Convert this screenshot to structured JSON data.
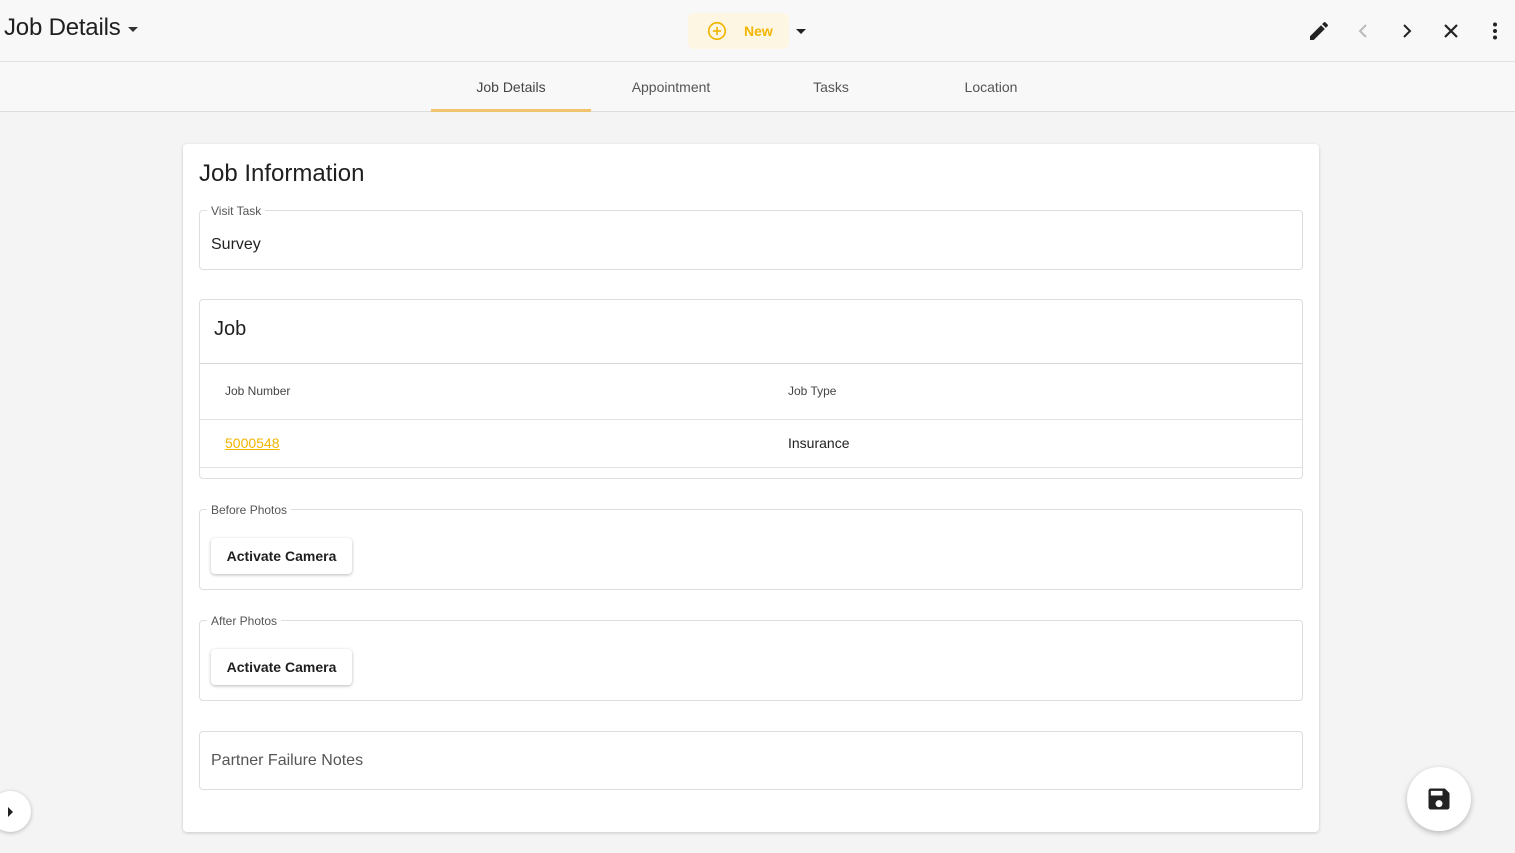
{
  "header": {
    "title": "Job Details",
    "new_label": "New",
    "icons": [
      "edit-icon",
      "chevron-left-icon",
      "chevron-right-icon",
      "close-icon",
      "more-vert-icon"
    ]
  },
  "tabs": [
    {
      "label": "Job Details",
      "active": true
    },
    {
      "label": "Appointment",
      "active": false
    },
    {
      "label": "Tasks",
      "active": false
    },
    {
      "label": "Location",
      "active": false
    }
  ],
  "section": {
    "title": "Job Information",
    "visit_task": {
      "label": "Visit Task",
      "value": "Survey"
    },
    "job": {
      "title": "Job",
      "columns": [
        "Job Number",
        "Job Type"
      ],
      "rows": [
        {
          "job_number": "5000548",
          "job_type": "Insurance"
        }
      ]
    },
    "before_photos": {
      "label": "Before Photos",
      "button": "Activate Camera"
    },
    "after_photos": {
      "label": "After Photos",
      "button": "Activate Camera"
    },
    "partner_failure_notes": {
      "placeholder": "Partner Failure Notes"
    }
  },
  "colors": {
    "accent": "#f2b500",
    "tab_indicator": "#f0c36d",
    "new_button_bg": "#fdf6e3"
  },
  "fab_icon": "save-icon"
}
